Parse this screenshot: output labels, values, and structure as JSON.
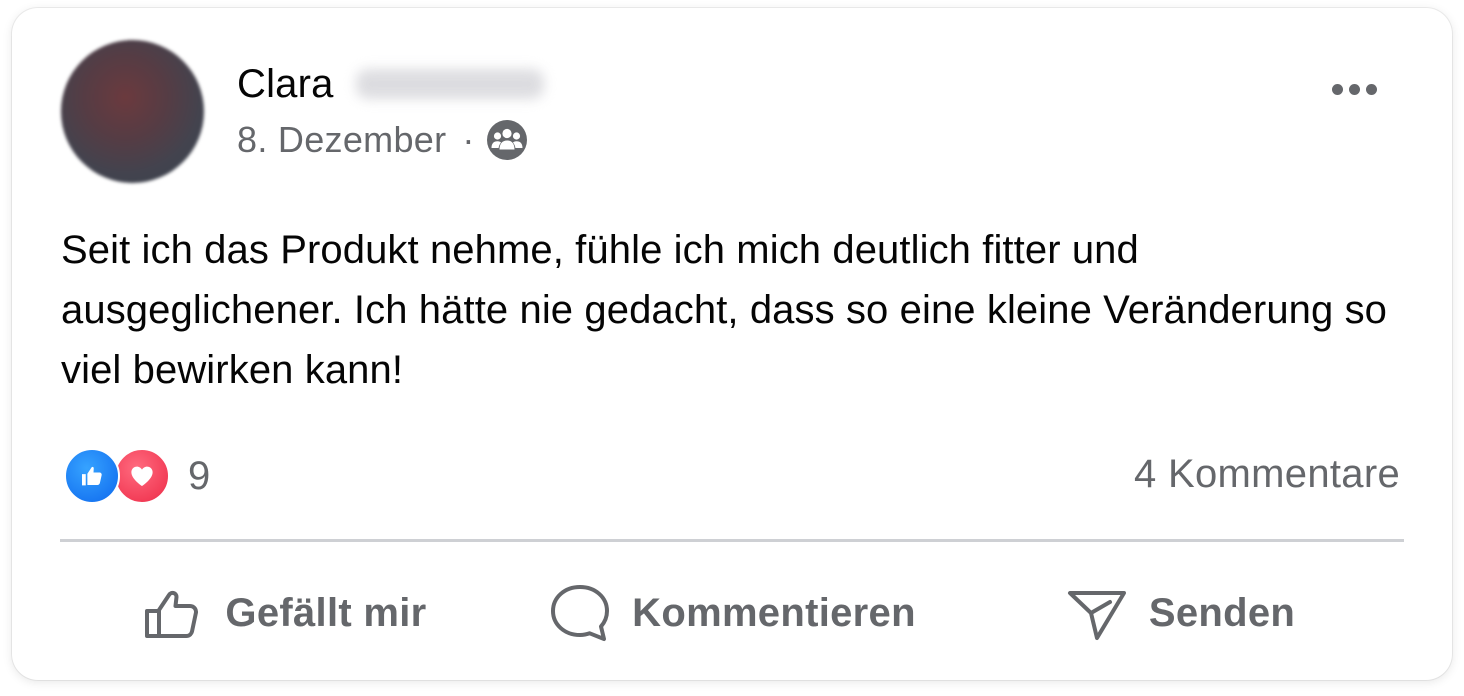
{
  "post": {
    "author_first_name": "Clara",
    "date": "8. Dezember",
    "separator": "·",
    "audience_icon": "group-icon",
    "text": "Seit ich das Produkt nehme, fühle ich mich deutlich fitter und ausgeglichener. Ich hätte nie gedacht, dass so eine kleine Veränderung so viel bewirken kann!"
  },
  "reactions": {
    "types": [
      "like",
      "love"
    ],
    "count": "9",
    "comments_label": "4 Kommentare"
  },
  "actions": {
    "like_label": "Gefällt mir",
    "comment_label": "Kommentieren",
    "share_label": "Senden"
  },
  "colors": {
    "secondary_text": "#65676b",
    "primary_text": "#050505",
    "like_blue": "#1877f2",
    "love_red": "#f33e58",
    "divider": "#ced0d4"
  }
}
